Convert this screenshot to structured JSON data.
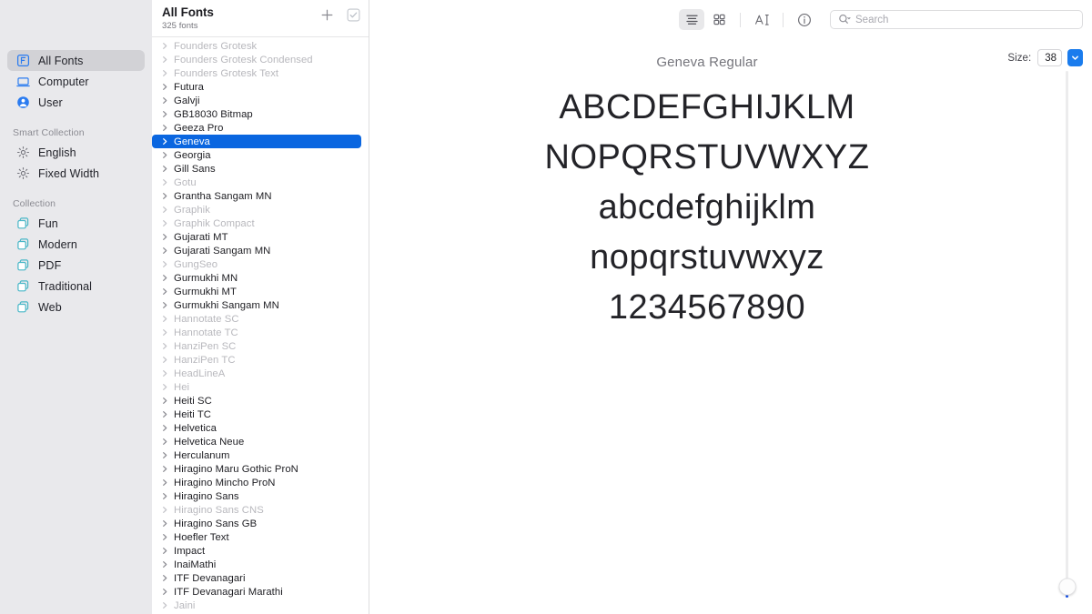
{
  "sidebar": {
    "groups": [
      {
        "header": null,
        "items": [
          {
            "label": "All Fonts",
            "icon": "all-fonts-icon",
            "selected": true
          },
          {
            "label": "Computer",
            "icon": "computer-icon",
            "selected": false
          },
          {
            "label": "User",
            "icon": "user-icon",
            "selected": false
          }
        ]
      },
      {
        "header": "Smart Collection",
        "items": [
          {
            "label": "English",
            "icon": "gear-icon",
            "selected": false
          },
          {
            "label": "Fixed Width",
            "icon": "gear-icon",
            "selected": false
          }
        ]
      },
      {
        "header": "Collection",
        "items": [
          {
            "label": "Fun",
            "icon": "collection-icon",
            "selected": false
          },
          {
            "label": "Modern",
            "icon": "collection-icon",
            "selected": false
          },
          {
            "label": "PDF",
            "icon": "collection-icon",
            "selected": false
          },
          {
            "label": "Traditional",
            "icon": "collection-icon",
            "selected": false
          },
          {
            "label": "Web",
            "icon": "collection-icon",
            "selected": false
          }
        ]
      }
    ]
  },
  "list_panel": {
    "title": "All Fonts",
    "subtitle": "325 fonts",
    "add_icon": "plus-icon",
    "validate_icon": "checkbox-icon",
    "fonts": [
      {
        "name": "Founders Grotesk",
        "disabled": true,
        "selected": false
      },
      {
        "name": "Founders Grotesk Condensed",
        "disabled": true,
        "selected": false
      },
      {
        "name": "Founders Grotesk Text",
        "disabled": true,
        "selected": false
      },
      {
        "name": "Futura",
        "disabled": false,
        "selected": false
      },
      {
        "name": "Galvji",
        "disabled": false,
        "selected": false
      },
      {
        "name": "GB18030 Bitmap",
        "disabled": false,
        "selected": false
      },
      {
        "name": "Geeza Pro",
        "disabled": false,
        "selected": false
      },
      {
        "name": "Geneva",
        "disabled": false,
        "selected": true
      },
      {
        "name": "Georgia",
        "disabled": false,
        "selected": false
      },
      {
        "name": "Gill Sans",
        "disabled": false,
        "selected": false
      },
      {
        "name": "Gotu",
        "disabled": true,
        "selected": false
      },
      {
        "name": "Grantha Sangam MN",
        "disabled": false,
        "selected": false
      },
      {
        "name": "Graphik",
        "disabled": true,
        "selected": false
      },
      {
        "name": "Graphik Compact",
        "disabled": true,
        "selected": false
      },
      {
        "name": "Gujarati MT",
        "disabled": false,
        "selected": false
      },
      {
        "name": "Gujarati Sangam MN",
        "disabled": false,
        "selected": false
      },
      {
        "name": "GungSeo",
        "disabled": true,
        "selected": false
      },
      {
        "name": "Gurmukhi MN",
        "disabled": false,
        "selected": false
      },
      {
        "name": "Gurmukhi MT",
        "disabled": false,
        "selected": false
      },
      {
        "name": "Gurmukhi Sangam MN",
        "disabled": false,
        "selected": false
      },
      {
        "name": "Hannotate SC",
        "disabled": true,
        "selected": false
      },
      {
        "name": "Hannotate TC",
        "disabled": true,
        "selected": false
      },
      {
        "name": "HanziPen SC",
        "disabled": true,
        "selected": false
      },
      {
        "name": "HanziPen TC",
        "disabled": true,
        "selected": false
      },
      {
        "name": "HeadLineA",
        "disabled": true,
        "selected": false
      },
      {
        "name": "Hei",
        "disabled": true,
        "selected": false
      },
      {
        "name": "Heiti SC",
        "disabled": false,
        "selected": false
      },
      {
        "name": "Heiti TC",
        "disabled": false,
        "selected": false
      },
      {
        "name": "Helvetica",
        "disabled": false,
        "selected": false
      },
      {
        "name": "Helvetica Neue",
        "disabled": false,
        "selected": false
      },
      {
        "name": "Herculanum",
        "disabled": false,
        "selected": false
      },
      {
        "name": "Hiragino Maru Gothic ProN",
        "disabled": false,
        "selected": false
      },
      {
        "name": "Hiragino Mincho ProN",
        "disabled": false,
        "selected": false
      },
      {
        "name": "Hiragino Sans",
        "disabled": false,
        "selected": false
      },
      {
        "name": "Hiragino Sans CNS",
        "disabled": true,
        "selected": false
      },
      {
        "name": "Hiragino Sans GB",
        "disabled": false,
        "selected": false
      },
      {
        "name": "Hoefler Text",
        "disabled": false,
        "selected": false
      },
      {
        "name": "Impact",
        "disabled": false,
        "selected": false
      },
      {
        "name": "InaiMathi",
        "disabled": false,
        "selected": false
      },
      {
        "name": "ITF Devanagari",
        "disabled": false,
        "selected": false
      },
      {
        "name": "ITF Devanagari Marathi",
        "disabled": false,
        "selected": false
      },
      {
        "name": "Jaini",
        "disabled": true,
        "selected": false
      }
    ]
  },
  "toolbar": {
    "list_view_icon": "list-view-icon",
    "grid_view_icon": "grid-view-icon",
    "sample_text_icon": "text-cursor-icon",
    "info_icon": "info-icon",
    "search_icon": "search-icon",
    "search_placeholder": "Search",
    "search_value": ""
  },
  "preview": {
    "size_label": "Size:",
    "size_value": "38",
    "stepper_icon": "chevron-down-icon",
    "font_title": "Geneva Regular",
    "specimen_lines": [
      "ABCDEFGHIJKLM",
      "NOPQRSTUVWXYZ",
      "abcdefghijklm",
      "nopqrstuvwxyz",
      "1234567890"
    ],
    "specimen_font_px": 38
  },
  "colors": {
    "accent": "#0a66e0",
    "slider_fill": "#1a56ef",
    "stepper": "#1a7ced",
    "sidebar_bg": "#e9e9ec",
    "sidebar_selected": "#d2d2d6",
    "dim_text": "#b8b8bd"
  }
}
